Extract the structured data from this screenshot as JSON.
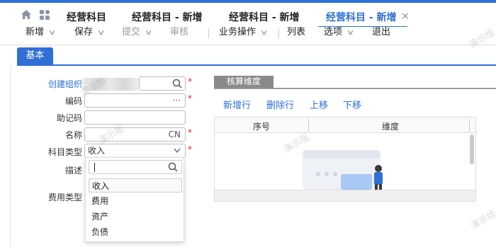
{
  "tabs": [
    {
      "label": "经营科目"
    },
    {
      "label": "经营科目 - 新增"
    },
    {
      "label": "经营科目 - 新增"
    },
    {
      "label": "经营科目 - 新增",
      "close": "×"
    }
  ],
  "toolbar": {
    "items": [
      {
        "label": "新增"
      },
      {
        "label": "保存"
      },
      {
        "label": "提交"
      },
      {
        "label": "审核"
      },
      {
        "label": "业务操作"
      },
      {
        "label": "列表"
      },
      {
        "label": "选项"
      },
      {
        "label": "退出"
      }
    ]
  },
  "page_tab": "基本",
  "form": {
    "org_label": "创建组织",
    "code_label": "编码",
    "code_suffix": "···",
    "mnemonic_label": "助记码",
    "name_label": "名称",
    "name_suffix": "CN",
    "type_label": "科目类型",
    "type_value": "收入",
    "desc_label": "描述",
    "fee_type_label": "费用类型",
    "required_mark": "*"
  },
  "dropdown": {
    "options": [
      "收入",
      "费用",
      "资产",
      "负债"
    ],
    "selected": "收入"
  },
  "right_panel": {
    "tab": "核算维度",
    "actions": [
      "新增行",
      "删除行",
      "上移",
      "下移"
    ],
    "columns": [
      "序号",
      "维度"
    ]
  },
  "watermark": "演示版",
  "colors": {
    "accent": "#2f6fd6",
    "required": "#e02020"
  }
}
